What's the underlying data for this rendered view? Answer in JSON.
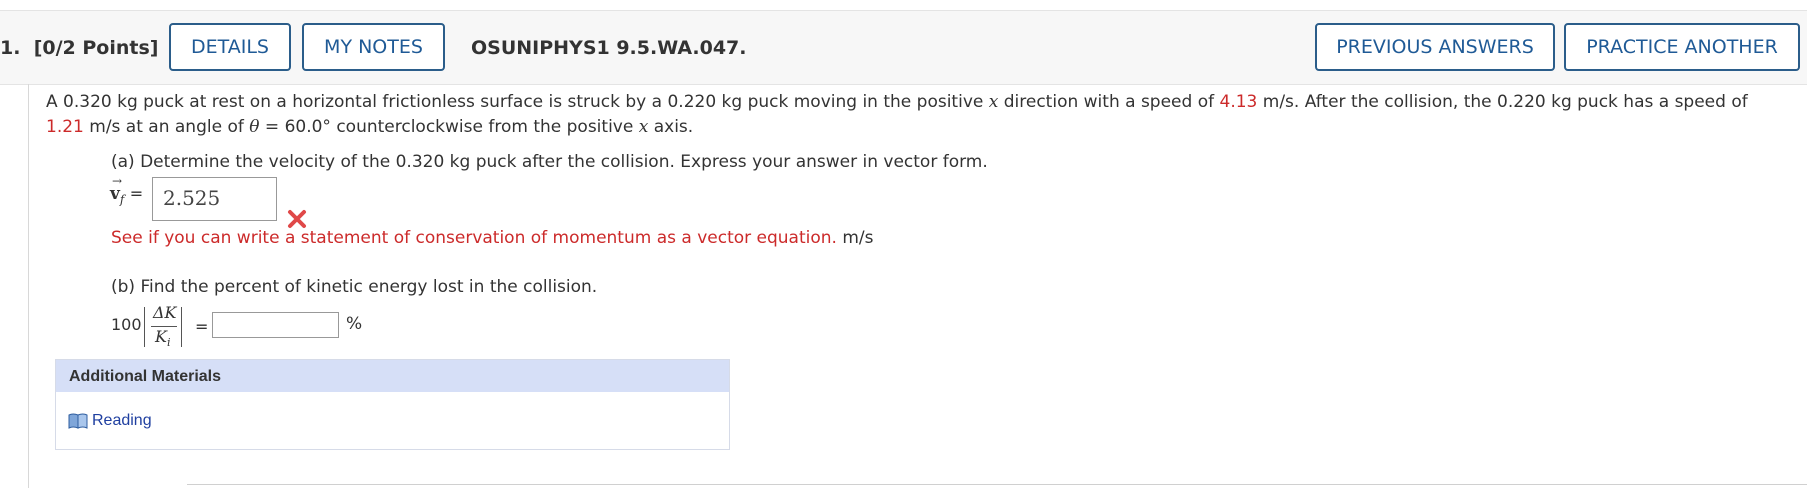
{
  "header": {
    "question_number": "1.",
    "points": "[0/2 Points]",
    "details_label": "DETAILS",
    "my_notes_label": "MY NOTES",
    "question_code": "OSUNIPHYS1 9.5.WA.047.",
    "previous_answers_label": "PREVIOUS ANSWERS",
    "practice_another_label": "PRACTICE ANOTHER"
  },
  "problem": {
    "text_1": "A 0.320 kg puck at rest on a horizontal frictionless surface is struck by a 0.220 kg puck moving in the positive ",
    "x1": "x",
    "text_2": " direction with a speed of ",
    "speed_1": "4.13",
    "text_3": " m/s. After the collision, the 0.220 kg puck has a speed of ",
    "speed_2": "1.21",
    "text_4": " m/s at an angle of ",
    "theta": "θ",
    "text_5": " = 60.0° counterclockwise from the positive ",
    "x2": "x",
    "text_6": " axis."
  },
  "part_a": {
    "prompt": "(a) Determine the velocity of the 0.320 kg puck after the collision. Express your answer in vector form.",
    "var_label": "v",
    "var_sub": "f",
    "equals": "=",
    "answer_value": "2.525",
    "hint": "See if you can write a statement of conservation of momentum as a vector equation.",
    "unit": "m/s"
  },
  "part_b": {
    "prompt": "(b) Find the percent of kinetic energy lost in the collision.",
    "coefficient": "100",
    "numerator": "ΔK",
    "denominator_base": "K",
    "denominator_sub": "i",
    "equals": "=",
    "answer_value": "",
    "unit": "%"
  },
  "additional_materials": {
    "title": "Additional Materials",
    "reading_label": "Reading"
  },
  "colors": {
    "accent": "#1f5a96",
    "error": "#cc2a2a",
    "panel_header": "#d6dff7"
  }
}
